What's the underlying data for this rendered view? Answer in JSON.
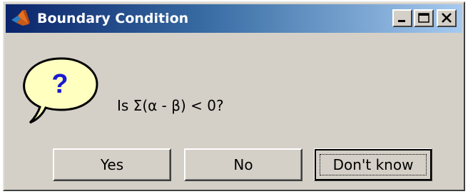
{
  "window": {
    "title": "Boundary Condition",
    "icon": "matlab-logo-icon",
    "controls": {
      "minimize": "minimize-icon",
      "maximize": "maximize-icon",
      "close": "close-icon"
    }
  },
  "dialog": {
    "icon": "question-balloon-icon",
    "icon_symbol": "?",
    "message": "Is Σ(α - β) < 0?",
    "buttons": {
      "yes": "Yes",
      "no": "No",
      "dont_know": "Don't know"
    },
    "default_button": "dont_know"
  },
  "colors": {
    "face": "#d4d0c8",
    "title_start": "#0a246a",
    "title_end": "#a6caf0",
    "balloon_fill": "#ffffc0",
    "question_mark": "#1a1ad0"
  }
}
